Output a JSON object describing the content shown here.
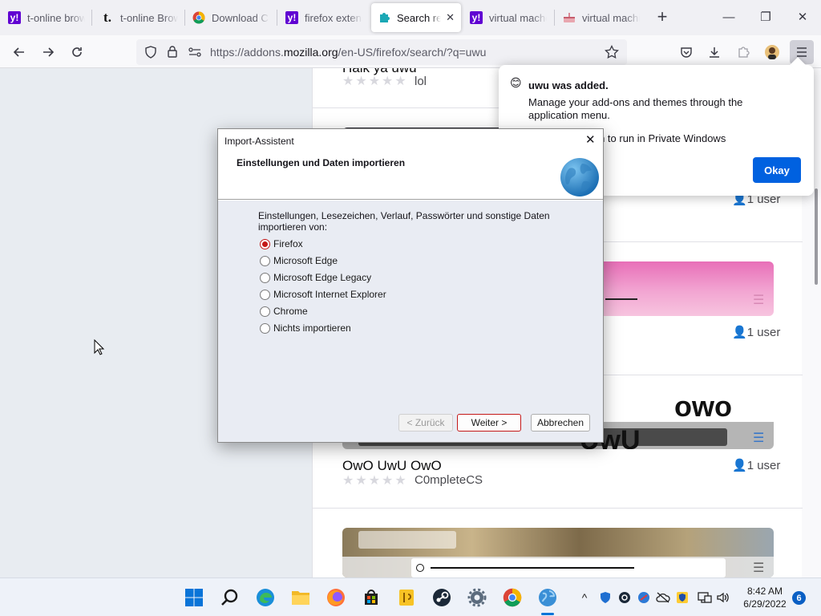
{
  "tabs": [
    {
      "title": "t-online brow",
      "favicon": "yahoo-favicon"
    },
    {
      "title": "t-online Brow",
      "favicon": "tonline-favicon"
    },
    {
      "title": "Download Ch",
      "favicon": "chrome-favicon"
    },
    {
      "title": "firefox extens",
      "favicon": "yahoo-favicon"
    },
    {
      "title": "Search res",
      "favicon": "puzzle-favicon",
      "active": true
    },
    {
      "title": "virtual mache",
      "favicon": "yahoo-favicon"
    },
    {
      "title": "virtual machi",
      "favicon": "cake-favicon"
    }
  ],
  "url": {
    "prefix": "https://addons.",
    "domain": "mozilla.org",
    "path": "/en-US/firefox/search/?q=uwu"
  },
  "results": [
    {
      "title": "Haik ya uwu",
      "author": "lol"
    },
    {
      "users": "1 user"
    },
    {
      "users": "1 user"
    },
    {
      "title": "OwO UwU OwO",
      "author": "C0mpleteCS",
      "users": "1 user"
    }
  ],
  "preview_text": {
    "owo": "owo",
    "uwu": "UwU"
  },
  "popup": {
    "title": "uwu was added.",
    "line1": "Manage your add-ons and themes through the application menu.",
    "line2": "ension to run in Private Windows",
    "okay": "Okay"
  },
  "dialog": {
    "window_title": "Import-Assistent",
    "heading": "Einstellungen und Daten importieren",
    "prompt": "Einstellungen, Lesezeichen, Verlauf, Passwörter und sonstige Daten importieren von:",
    "options": [
      {
        "label": "Firefox",
        "selected": true
      },
      {
        "label": "Microsoft Edge"
      },
      {
        "label": "Microsoft Edge Legacy"
      },
      {
        "label": "Microsoft Internet Explorer"
      },
      {
        "label": "Chrome"
      },
      {
        "label": "Nichts importieren"
      }
    ],
    "back": "< Zurück",
    "next": "Weiter >",
    "cancel": "Abbrechen"
  },
  "taskbar": {
    "time": "8:42 AM",
    "date": "6/29/2022",
    "notifications": "6"
  },
  "colors": {
    "accent": "#0061e0",
    "radio_selected": "#c41818",
    "yahoo": "#6001d2"
  }
}
